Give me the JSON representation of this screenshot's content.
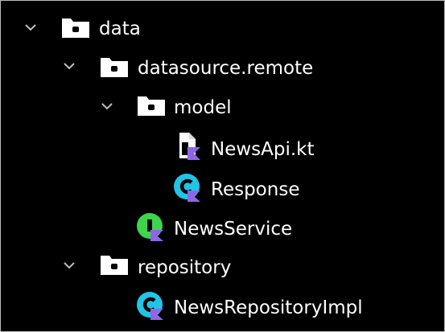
{
  "tree": {
    "items": [
      {
        "id": "data",
        "label": "data",
        "type": "folder",
        "expanded": true,
        "depth": 0,
        "icon": "folder-icon"
      },
      {
        "id": "datasource",
        "label": "datasource.remote",
        "type": "package",
        "expanded": true,
        "depth": 1,
        "icon": "package-icon"
      },
      {
        "id": "model",
        "label": "model",
        "type": "package",
        "expanded": true,
        "depth": 2,
        "icon": "package-icon"
      },
      {
        "id": "newsapi",
        "label": "NewsApi.kt",
        "type": "kotlin-file",
        "depth": 3,
        "icon": "kotlin-file-icon"
      },
      {
        "id": "response",
        "label": "Response",
        "type": "kotlin-class",
        "depth": 3,
        "icon": "kotlin-class-icon"
      },
      {
        "id": "newsservice",
        "label": "NewsService",
        "type": "kotlin-interface",
        "depth": 2,
        "icon": "kotlin-interface-icon"
      },
      {
        "id": "repository",
        "label": "repository",
        "type": "package",
        "expanded": true,
        "depth": 1,
        "icon": "package-icon"
      },
      {
        "id": "newsrepoimpl",
        "label": "NewsRepositoryImpl",
        "type": "kotlin-class",
        "depth": 2,
        "icon": "kotlin-class-icon"
      }
    ]
  },
  "colors": {
    "background": "#000000",
    "text": "#ffffff",
    "chevron": "#bfbfbf",
    "kotlin_badge": "#8e66e6",
    "class_icon": "#22c4e6",
    "interface_icon": "#3dd64a"
  }
}
